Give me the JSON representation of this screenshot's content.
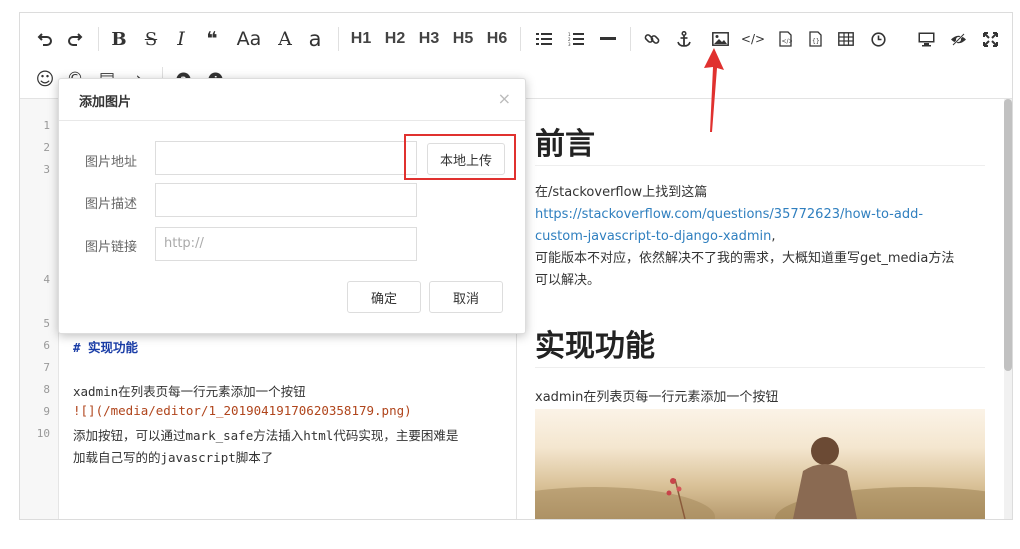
{
  "toolbar": {
    "row1": [
      {
        "name": "undo-icon",
        "glyph": "↶"
      },
      {
        "name": "redo-icon",
        "glyph": "↷"
      },
      {
        "name": "bold-icon",
        "glyph": "B"
      },
      {
        "name": "strikethrough-icon",
        "glyph": "S"
      },
      {
        "name": "italic-icon",
        "glyph": "I"
      },
      {
        "name": "quote-icon",
        "glyph": "❝"
      },
      {
        "name": "uppercase-icon",
        "glyph": "Aa"
      },
      {
        "name": "uppercase-all-icon",
        "glyph": "A"
      },
      {
        "name": "lowercase-icon",
        "glyph": "a"
      },
      {
        "name": "heading-1",
        "glyph": "H1"
      },
      {
        "name": "heading-2",
        "glyph": "H2"
      },
      {
        "name": "heading-3",
        "glyph": "H3"
      },
      {
        "name": "heading-5",
        "glyph": "H5"
      },
      {
        "name": "heading-6",
        "glyph": "H6"
      },
      {
        "name": "unordered-list-icon",
        "glyph": "☰"
      },
      {
        "name": "ordered-list-icon",
        "glyph": "☷"
      },
      {
        "name": "horizontal-rule-icon",
        "glyph": "—"
      },
      {
        "name": "link-icon",
        "glyph": "🔗"
      },
      {
        "name": "anchor-icon",
        "glyph": "⚓"
      },
      {
        "name": "image-icon",
        "glyph": "▣"
      },
      {
        "name": "code-icon",
        "glyph": "</>"
      },
      {
        "name": "code-block-icon",
        "glyph": "▤"
      },
      {
        "name": "preformatted-icon",
        "glyph": "▥"
      },
      {
        "name": "table-icon",
        "glyph": "▦"
      },
      {
        "name": "datetime-icon",
        "glyph": "◷"
      },
      {
        "name": "watch-preview-icon",
        "glyph": "▭"
      },
      {
        "name": "toggle-preview-icon",
        "glyph": "◉"
      },
      {
        "name": "fullscreen-icon",
        "glyph": "✕"
      }
    ],
    "row2": [
      {
        "name": "emoji-icon",
        "glyph": "☺"
      },
      {
        "name": "html-entities-icon",
        "glyph": "©"
      },
      {
        "name": "goto-line-icon",
        "glyph": "▤"
      },
      {
        "name": "more-icon",
        "glyph": "›"
      },
      {
        "name": "help-icon",
        "glyph": "?"
      },
      {
        "name": "info-icon",
        "glyph": "i"
      }
    ]
  },
  "editor": {
    "line_numbers": [
      "1",
      "2",
      "3",
      "4",
      "5",
      "6",
      "7",
      "8",
      "9",
      "10"
    ],
    "lines": {
      "l6": "# 实现功能",
      "l8": "xadmin在列表页每一行元素添加一个按钮",
      "l9": "![](/media/editor/1_20190419170620358179.png)",
      "l10a": "添加按钮，可以通过mark_safe方法插入html代码实现，主要困难是",
      "l10b": "加载自己写的的javascript脚本了"
    }
  },
  "preview": {
    "h1_intro": "前言",
    "p1": "在/stackoverflow上找到这篇",
    "link_a": "https://stackoverflow.com/questions/35772623/how-to-add-",
    "link_b": "custom-javascript-to-django-xadmin",
    "link_comma": ",",
    "p2": "可能版本不对应，依然解决不了我的需求，大概知道重写get_media方法",
    "p3": "可以解决。",
    "h1_feature": "实现功能",
    "p4": "xadmin在列表页每一行元素添加一个按钮"
  },
  "dialog": {
    "title": "添加图片",
    "close": "×",
    "url_label": "图片地址",
    "url_value": "",
    "upload_button": "本地上传",
    "alt_label": "图片描述",
    "alt_value": "",
    "link_label": "图片链接",
    "link_placeholder": "http://",
    "confirm_button": "确定",
    "cancel_button": "取消"
  },
  "colors": {
    "annotation_red": "#e0312f",
    "link_blue": "#2f7fbf",
    "heading_code": "#1a3da7",
    "image_link_code": "#b0451c"
  }
}
